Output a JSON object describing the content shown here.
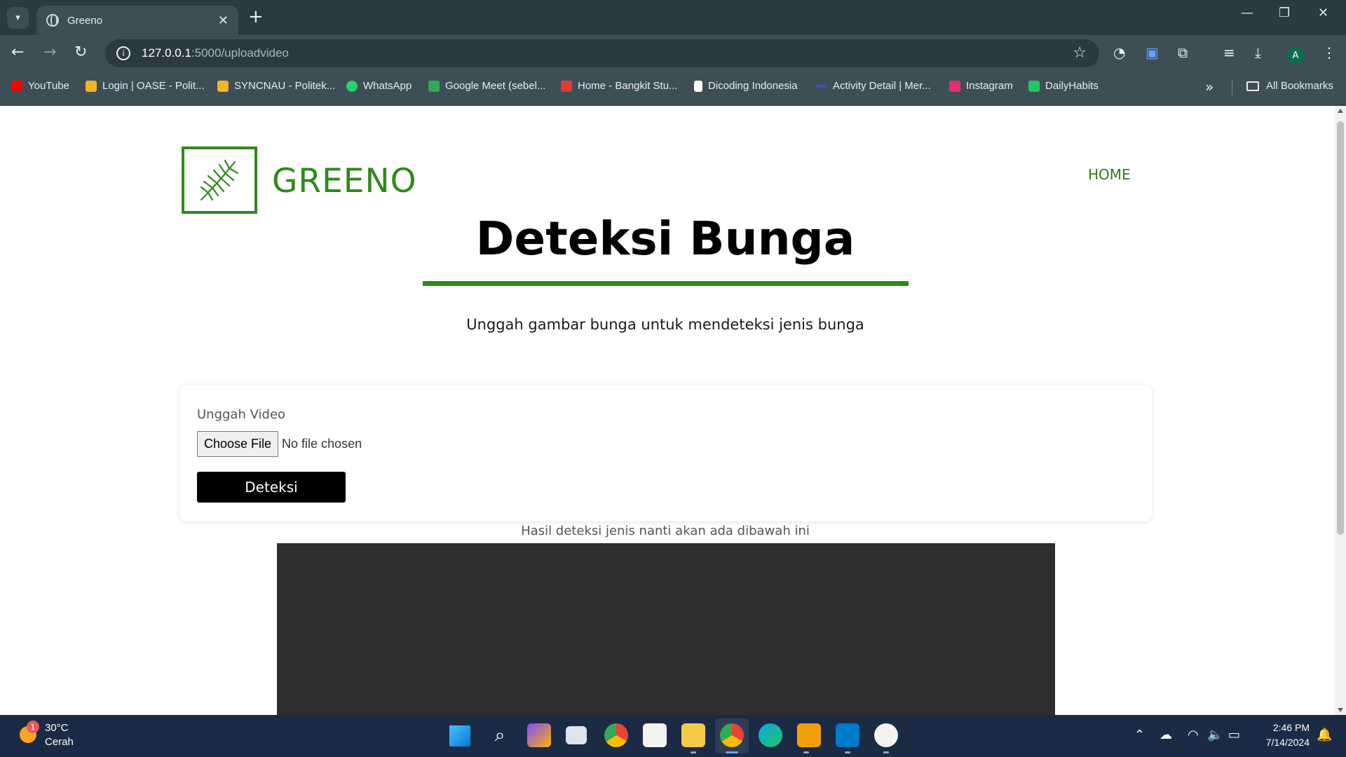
{
  "browser": {
    "tab_title": "Greeno",
    "url_host": "127.0.0.1",
    "url_rest": ":5000/uploadvideo",
    "profile_initial": "A",
    "bookmarks": [
      {
        "label": "YouTube",
        "color": "#ff0000"
      },
      {
        "label": "Login | OASE - Polit...",
        "color": "#f0b429"
      },
      {
        "label": "SYNCNAU - Politek...",
        "color": "#f0b429"
      },
      {
        "label": "WhatsApp",
        "color": "#25d366"
      },
      {
        "label": "Google Meet (sebel...",
        "color": "#34a853"
      },
      {
        "label": "Home - Bangkit Stu...",
        "color": "#e53935"
      },
      {
        "label": "Dicoding Indonesia",
        "color": "#ffffff"
      },
      {
        "label": "Activity Detail | Mer...",
        "color": "#3f51b5"
      },
      {
        "label": "Instagram",
        "color": "#e1306c"
      },
      {
        "label": "DailyHabits",
        "color": "#22c55e"
      }
    ],
    "all_bookmarks_label": "All Bookmarks"
  },
  "page": {
    "brand_name": "GREENO",
    "nav_home": "HOME",
    "title": "Deteksi Bunga",
    "subtitle": "Unggah gambar bunga untuk mendeteksi jenis bunga",
    "upload_label": "Unggah Video",
    "file_button": "Choose File",
    "file_status": "No file chosen",
    "submit_label": "Deteksi",
    "result_note": "Hasil deteksi jenis nanti akan ada dibawah ini",
    "accent_color": "#2e8a18"
  },
  "taskbar": {
    "weather_temp": "30°C",
    "weather_desc": "Cerah",
    "weather_badge": "1",
    "time": "2:46 PM",
    "date": "7/14/2024"
  }
}
